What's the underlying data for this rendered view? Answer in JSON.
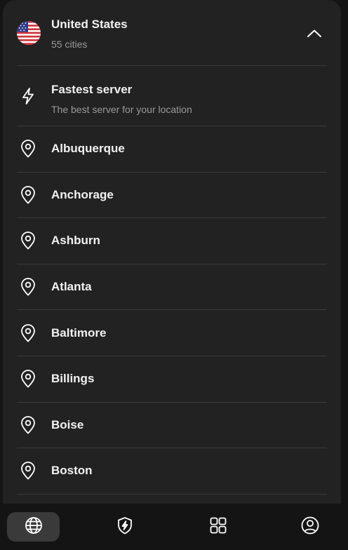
{
  "country": {
    "name": "United States",
    "subtitle": "55 cities",
    "flag_icon": "us-flag-icon",
    "expanded": true
  },
  "fastest": {
    "label": "Fastest server",
    "sublabel": "The best server for your location",
    "icon": "lightning-icon"
  },
  "cities": [
    {
      "label": "Albuquerque"
    },
    {
      "label": "Anchorage"
    },
    {
      "label": "Ashburn"
    },
    {
      "label": "Atlanta"
    },
    {
      "label": "Baltimore"
    },
    {
      "label": "Billings"
    },
    {
      "label": "Boise"
    },
    {
      "label": "Boston"
    }
  ],
  "nav": {
    "items": [
      {
        "icon": "globe-icon",
        "active": true
      },
      {
        "icon": "shield-bolt-icon",
        "active": false
      },
      {
        "icon": "grid-icon",
        "active": false
      },
      {
        "icon": "account-icon",
        "active": false
      }
    ]
  },
  "colors": {
    "background": "#141414",
    "panel": "#222222",
    "divider": "#3a3a3a",
    "active_nav": "#3a3a3a",
    "secondary_text": "#9a9a9a"
  }
}
